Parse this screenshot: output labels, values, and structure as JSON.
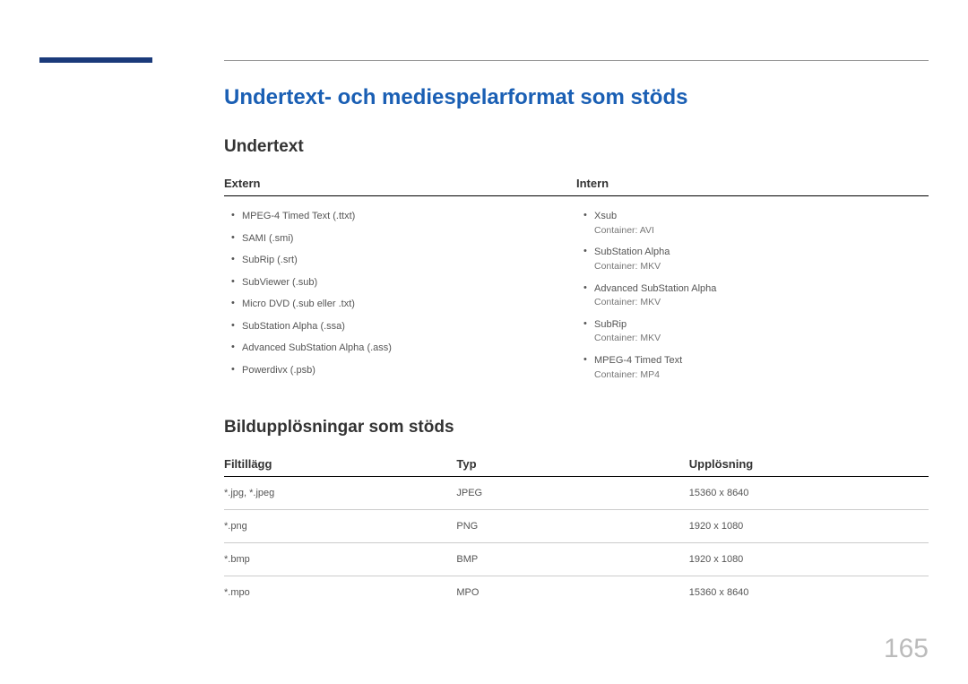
{
  "mainTitle": "Undertext- och mediespelarformat som stöds",
  "section1": {
    "title": "Undertext",
    "headers": {
      "left": "Extern",
      "right": "Intern"
    },
    "extern": [
      {
        "name": "MPEG-4 Timed Text (.ttxt)"
      },
      {
        "name": "SAMI (.smi)"
      },
      {
        "name": "SubRip (.srt)"
      },
      {
        "name": "SubViewer (.sub)"
      },
      {
        "name": "Micro DVD (.sub eller .txt)"
      },
      {
        "name": "SubStation Alpha (.ssa)"
      },
      {
        "name": "Advanced SubStation Alpha (.ass)"
      },
      {
        "name": "Powerdivx (.psb)"
      }
    ],
    "intern": [
      {
        "name": "Xsub",
        "container": "Container: AVI"
      },
      {
        "name": "SubStation Alpha",
        "container": "Container: MKV"
      },
      {
        "name": "Advanced SubStation Alpha",
        "container": "Container: MKV"
      },
      {
        "name": "SubRip",
        "container": "Container: MKV"
      },
      {
        "name": "MPEG-4 Timed Text",
        "container": "Container: MP4"
      }
    ]
  },
  "section2": {
    "title": "Bildupplösningar som stöds",
    "headers": {
      "ext": "Filtillägg",
      "type": "Typ",
      "res": "Upplösning"
    },
    "rows": [
      {
        "ext": "*.jpg, *.jpeg",
        "type": "JPEG",
        "res": "15360 x 8640"
      },
      {
        "ext": "*.png",
        "type": "PNG",
        "res": "1920 x 1080"
      },
      {
        "ext": "*.bmp",
        "type": "BMP",
        "res": "1920 x 1080"
      },
      {
        "ext": "*.mpo",
        "type": "MPO",
        "res": "15360 x 8640"
      }
    ]
  },
  "pageNumber": "165"
}
